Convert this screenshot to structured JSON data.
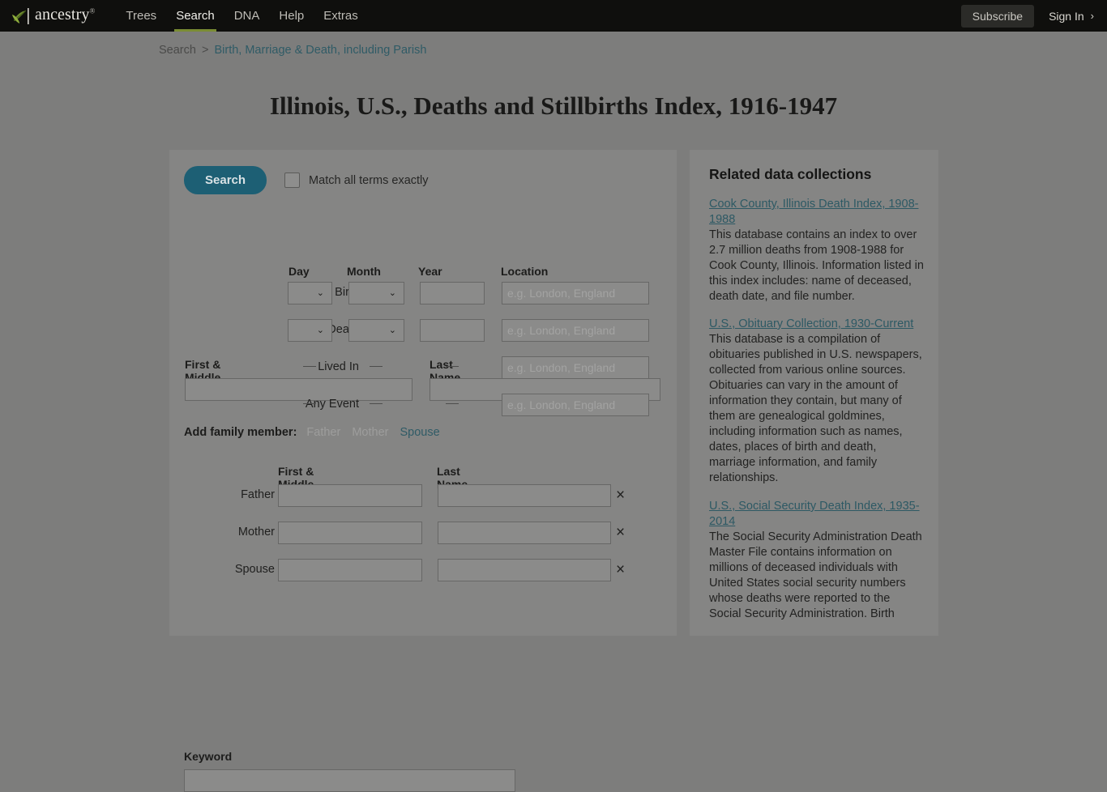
{
  "navbar": {
    "logo_text": "ancestry",
    "logo_tm": "®",
    "links": [
      {
        "label": "Trees",
        "active": false
      },
      {
        "label": "Search",
        "active": true
      },
      {
        "label": "DNA",
        "active": false
      },
      {
        "label": "Help",
        "active": false
      },
      {
        "label": "Extras",
        "active": false
      }
    ],
    "subscribe_label": "Subscribe",
    "signin_label": "Sign In",
    "signin_chevron": "›"
  },
  "breadcrumb": {
    "root": "Search",
    "separator": ">",
    "current": "Birth, Marriage & Death, including Parish"
  },
  "page_title": "Illinois, U.S., Deaths and Stillbirths Index, 1916-1947",
  "form": {
    "search_button": "Search",
    "match_exact_label": "Match all terms exactly",
    "first_name_label": "First & Middle Name(s)",
    "last_name_label": "Last Name",
    "first_name_value": "",
    "last_name_value": "",
    "grid_headers": {
      "day": "Day",
      "month": "Month",
      "year": "Year",
      "location": "Location"
    },
    "location_placeholder": "e.g. London, England",
    "events": [
      {
        "label": "Birth",
        "has_selects": true,
        "year_value": "",
        "location_value": ""
      },
      {
        "label": "Death",
        "has_selects": true,
        "year_value": "",
        "location_value": ""
      },
      {
        "label": "Lived In",
        "has_selects": false,
        "year_value": "",
        "location_value": ""
      },
      {
        "label": "Any Event",
        "has_selects": false,
        "year_value": "",
        "location_value": ""
      }
    ],
    "select_day_value": "",
    "select_month_value": "",
    "chevron_down": "⌄",
    "family": {
      "heading": "Add family member:",
      "links": [
        {
          "label": "Father",
          "state": "disabled"
        },
        {
          "label": "Mother",
          "state": "disabled"
        },
        {
          "label": "Spouse",
          "state": "enabled"
        }
      ],
      "col_first": "First & Middle Name(s)",
      "col_last": "Last Name",
      "remove_icon": "×",
      "rows": [
        {
          "label": "Father",
          "first_value": "",
          "last_value": ""
        },
        {
          "label": "Mother",
          "first_value": "",
          "last_value": ""
        },
        {
          "label": "Spouse",
          "first_value": "",
          "last_value": ""
        }
      ]
    },
    "keyword_label": "Keyword",
    "keyword_value": ""
  },
  "sidebar": {
    "title": "Related data collections",
    "collections": [
      {
        "link": "Cook County, Illinois Death Index, 1908-1988",
        "desc": "This database contains an index to over 2.7 million deaths from 1908-1988 for Cook County, Illinois. Information listed in this index includes: name of deceased, death date, and file number."
      },
      {
        "link": "U.S., Obituary Collection, 1930-Current",
        "desc": "This database is a compilation of obituaries published in U.S. newspapers, collected from various online sources. Obituaries can vary in the amount of information they contain, but many of them are genealogical goldmines, including information such as names, dates, places of birth and death, marriage information, and family relationships."
      },
      {
        "link": "U.S., Social Security Death Index, 1935-2014",
        "desc": "The Social Security Administration Death Master File contains information on millions of deceased individuals with United States social security numbers whose deaths were reported to the Social Security Administration. Birth"
      }
    ]
  },
  "colors": {
    "nav_bg": "#0f0f0d",
    "page_bg": "#7d7d7c",
    "panel_bg": "#858584",
    "accent_teal": "#1d5f74",
    "accent_green": "#7a8c33",
    "link_teal": "#2d5964"
  }
}
